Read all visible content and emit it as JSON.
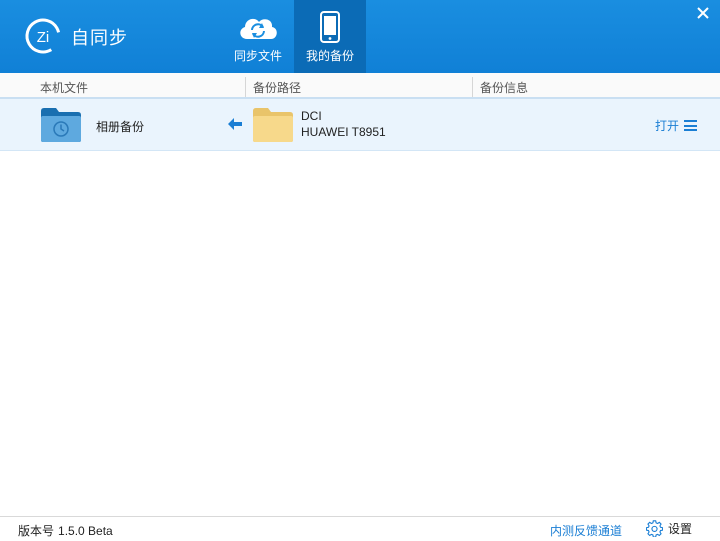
{
  "app": {
    "name": "自同步",
    "logo_text": "Zi",
    "brand_color": "#1a8ee0",
    "active_tab_color": "#0b6bb6"
  },
  "nav": {
    "tabs": [
      {
        "label": "同步文件",
        "icon": "cloud-sync-icon",
        "active": false
      },
      {
        "label": "我的备份",
        "icon": "phone-icon",
        "active": true
      }
    ]
  },
  "columns": {
    "local": "本机文件",
    "path": "备份路径",
    "info": "备份信息"
  },
  "backups": [
    {
      "local_name": "相册备份",
      "direction_icon": "arrow-left-icon",
      "dest_name": "DCI",
      "dest_device": "HUAWEI T8951",
      "action_label": "打开"
    }
  ],
  "footer": {
    "version_label": "版本号",
    "version": "1.5.0 Beta",
    "feedback_link": "内测反馈通道",
    "settings_label": "设置"
  }
}
